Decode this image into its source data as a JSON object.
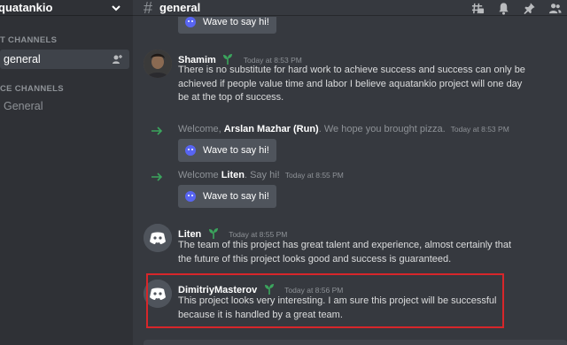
{
  "sidebar": {
    "server_name": "quatankio",
    "categories": [
      {
        "label": "T CHANNELS"
      },
      {
        "label": "CE CHANNELS"
      }
    ],
    "channels": [
      {
        "label": "general",
        "active": true
      },
      {
        "label": "General",
        "active": false
      }
    ]
  },
  "topbar": {
    "channel": "general",
    "icons": [
      "threads-icon",
      "bell-icon",
      "pin-icon",
      "members-icon"
    ]
  },
  "messages": {
    "top_wave_label": "Wave to say hi!",
    "shamim": {
      "author": "Shamim",
      "timestamp": "Today at 8:53 PM",
      "lines": [
        "There is no substitute for hard work to achieve success and success can only be",
        "achieved if people value time and labor I believe aquatankio project will one day",
        "be at the top of success."
      ]
    },
    "welcome1": {
      "prefix": "Welcome, ",
      "name": "Arslan Mazhar (Run)",
      "suffix": ". We hope you brought pizza.",
      "timestamp": "Today at 8:53 PM",
      "wave_label": "Wave to say hi!"
    },
    "welcome2": {
      "prefix": "Welcome ",
      "name": "Liten",
      "suffix": ". Say hi!",
      "timestamp": "Today at 8:55 PM",
      "wave_label": "Wave to say hi!"
    },
    "liten": {
      "author": "Liten",
      "timestamp": "Today at 8:55 PM",
      "lines": [
        "The team of this project has great talent and experience, almost certainly that",
        "the future of this project looks good and success is guaranteed."
      ]
    },
    "dimitriy": {
      "author": "DimitriyMasterov",
      "timestamp": "Today at 8:56 PM",
      "lines": [
        "This project looks very interesting. I am sure this project will be successful",
        "because it is handled by a great team."
      ]
    }
  },
  "colors": {
    "accent_green": "#3ba55d",
    "discord_blurple": "#5865f2",
    "highlight_red": "#d7262a"
  }
}
